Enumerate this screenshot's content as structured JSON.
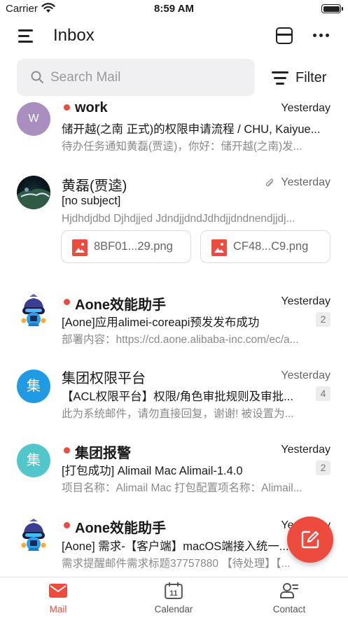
{
  "status_bar": {
    "carrier": "Carrier",
    "time": "8:59 AM"
  },
  "header": {
    "title": "Inbox"
  },
  "search": {
    "placeholder": "Search Mail",
    "filter_label": "Filter"
  },
  "colors": {
    "accent": "#ec4b3e",
    "unread_dot": "#ec4b3e"
  },
  "mails": [
    {
      "avatar_text": "W",
      "sender": "work",
      "unread": true,
      "date": "Yesterday",
      "subject": "储开越(之南 正式)的权限申请流程 / CHU, Kaiyue...",
      "preview": "待办任务通知黄磊(贾逵)，你好：储开越(之南)发..."
    },
    {
      "avatar_text": "",
      "sender": "黄磊(贾逵)",
      "unread": false,
      "has_attachment": true,
      "date": "Yesterday",
      "subject": "[no subject]",
      "preview": "Hjdhdjdbd Djhdjjed JdndjjdndJdhdjjdndnendjjdj...",
      "attachments": [
        {
          "name": "8BF01...29.png"
        },
        {
          "name": "CF48...C9.png"
        }
      ]
    },
    {
      "avatar_text": "",
      "sender": "Aone效能助手",
      "unread": true,
      "date": "Yesterday",
      "subject": "[Aone]应用alimei-coreapi预发发布成功",
      "preview": "部署内容：https://cd.aone.alibaba-inc.com/ec/a...",
      "count": "2"
    },
    {
      "avatar_text": "集",
      "sender": "集团权限平台",
      "unread": false,
      "date": "Yesterday",
      "subject": "【ACL权限平台】权限/角色审批规则及审批...",
      "preview": "此为系统邮件，请勿直接回复，谢谢! 被设置为...",
      "count": "4"
    },
    {
      "avatar_text": "集",
      "sender": "集团报警",
      "unread": true,
      "date": "Yesterday",
      "subject": "[打包成功] Alimail Mac Alimail-1.4.0",
      "preview": "项目名称：Alimail Mac 打包配置项名称：Alimail...",
      "count": "2"
    },
    {
      "avatar_text": "",
      "sender": "Aone效能助手",
      "unread": true,
      "date": "Yesterday",
      "subject": "[Aone] 需求-【客户端】macOS端接入统一...",
      "preview": "需求提醒邮件需求标题37757880 【待处理】【..."
    }
  ],
  "tabs": [
    {
      "label": "Mail",
      "active": true
    },
    {
      "label": "Calendar",
      "active": false,
      "icon_text": "11"
    },
    {
      "label": "Contact",
      "active": false
    }
  ]
}
